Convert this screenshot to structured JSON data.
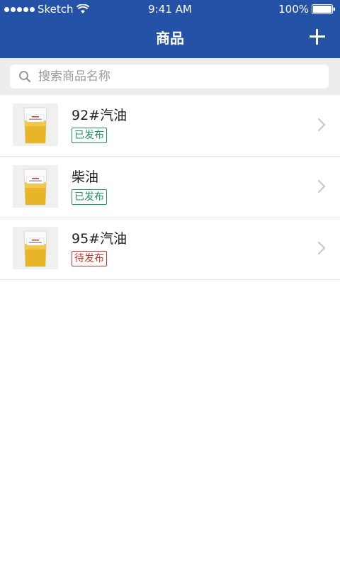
{
  "status_bar": {
    "carrier": "Sketch",
    "time": "9:41 AM",
    "battery": "100%"
  },
  "nav": {
    "title": "商品",
    "add_icon": "plus-icon"
  },
  "search": {
    "placeholder": "搜索商品名称",
    "icon": "search-icon"
  },
  "colors": {
    "header_bg": "#2352a6",
    "published": "#1f9a5a",
    "pending": "#d0382b"
  },
  "products": [
    {
      "name": "92#汽油",
      "status": "已发布",
      "status_type": "published"
    },
    {
      "name": "柴油",
      "status": "已发布",
      "status_type": "published"
    },
    {
      "name": "95#汽油",
      "status": "待发布",
      "status_type": "pending"
    }
  ]
}
